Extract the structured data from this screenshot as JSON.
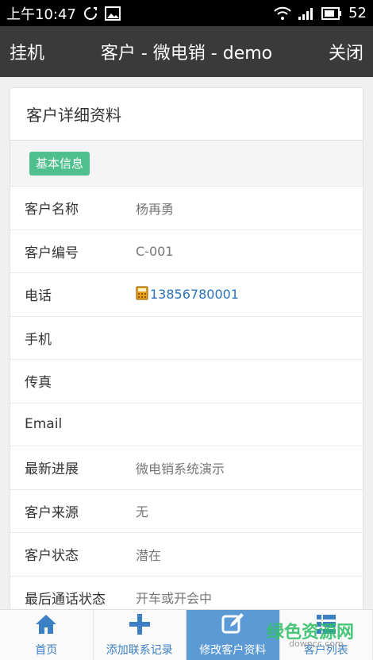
{
  "status_bar": {
    "time": "上午10:47",
    "battery": "52",
    "icons": [
      "sync-icon",
      "image-icon",
      "wifi-icon",
      "signal-icon",
      "battery-icon"
    ]
  },
  "app_bar": {
    "left_button": "挂机",
    "title": "客户 - 微电销 - demo",
    "right_button": "关闭"
  },
  "card": {
    "title": "客户详细资料",
    "section_badge": "基本信息",
    "rows": [
      {
        "label": "客户名称",
        "value": "杨再勇"
      },
      {
        "label": "客户编号",
        "value": "C-001"
      },
      {
        "label": "电话",
        "value": "13856780001"
      },
      {
        "label": "手机",
        "value": ""
      },
      {
        "label": "传真",
        "value": ""
      },
      {
        "label": "Email",
        "value": ""
      },
      {
        "label": "最新进展",
        "value": "微电销系统演示"
      },
      {
        "label": "客户来源",
        "value": "无"
      },
      {
        "label": "客户状态",
        "value": "潜在"
      },
      {
        "label": "最后通话状态",
        "value": "开车或开会中"
      }
    ]
  },
  "bottom_nav": {
    "items": [
      {
        "label": "首页",
        "icon": "home-icon"
      },
      {
        "label": "添加联系记录",
        "icon": "plus-icon"
      },
      {
        "label": "修改客户资料",
        "icon": "edit-icon"
      },
      {
        "label": "客户列表",
        "icon": "list-icon"
      }
    ],
    "active_index": 2
  },
  "watermark": {
    "text": "绿色资源网",
    "url": "downcc.com"
  },
  "colors": {
    "app_bar": "#3a3a3a",
    "badge": "#4fc08d",
    "nav_active": "#5c9ad6",
    "nav_text": "#3b7fc4",
    "link": "#2a73b8"
  }
}
